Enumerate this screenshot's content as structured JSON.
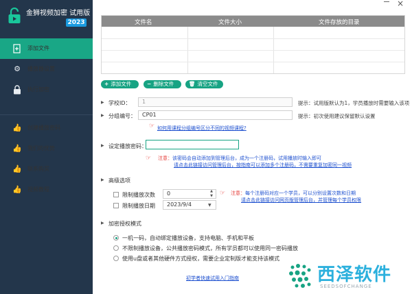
{
  "app": {
    "title": "金狮视频加密 试用版",
    "year_badge": "2023",
    "colors": {
      "sidebar": "#23364b",
      "accent": "#19a786",
      "badge": "#1a9be0",
      "link": "#1c4fcf",
      "warning": "#e53935"
    }
  },
  "sidebar": {
    "items": [
      {
        "label": "添加文件",
        "icon": "file-plus-icon",
        "active": true
      },
      {
        "label": "播放器设置",
        "icon": "gear-icon",
        "active": false
      },
      {
        "label": "执行加密",
        "icon": "lock-icon",
        "active": false
      },
      {
        "label": "创建播放密码",
        "icon": "thumbs-up-icon",
        "active": false
      },
      {
        "label": "我们的优势",
        "icon": "thumbs-up-icon",
        "active": false
      },
      {
        "label": "联系购买",
        "icon": "thumbs-up-icon",
        "active": false
      },
      {
        "label": "视频教程",
        "icon": "thumbs-up-icon",
        "active": false
      }
    ]
  },
  "files_table": {
    "headers": [
      "文件名",
      "文件大小",
      "文件存放的目录"
    ],
    "rows": []
  },
  "toolbar": {
    "add_file": "添加文件",
    "delete_file": "删除文件",
    "clear_files": "清空文件"
  },
  "form": {
    "school_id": {
      "label": "学校ID：",
      "value": "1",
      "hint": "提示：试用版默认为1，学员播放时需要输入该项"
    },
    "group_no": {
      "label": "分组编号：",
      "value": "CP01",
      "hint": "提示：初次使用建议保留默认设置"
    },
    "group_link": "如何用课程分组编号区分不同的视频课程?",
    "play_password": {
      "label": "设定播放密码：",
      "value": ""
    },
    "password_note_prefix": "注意：",
    "password_note_1": "该密码会自动添加到管理后台，成为一个注册码，试用播放时输入即可",
    "password_note_2": "请点击此链接访问管理后台，按指南可以添加多个注册码，不需要重复加密同一视频"
  },
  "advanced": {
    "title": "高级选项",
    "limit_count": {
      "label": "限制播放次数",
      "value": "0",
      "checked": false
    },
    "limit_date": {
      "label": "限制播放日期",
      "value": "2023/9/4",
      "checked": false
    },
    "note_prefix": "注意：",
    "note_1": "每个注册码对应一个学员，可以分别设置次数和日期",
    "note_2": "请点击此链接访问网页版管理后台，并管理每个学员权限"
  },
  "auth_mode": {
    "title": "加密授权模式",
    "options": [
      {
        "label": "一机一码，自动绑定播放设备，支持电脑、手机和平板",
        "selected": true
      },
      {
        "label": "不限制播放设备，公共播放密码模式，所有学员都可以使用同一密码播放",
        "selected": false
      },
      {
        "label": "使用u盘或者其他硬件方式授权，需要企业定制版才能支持该模式",
        "selected": false
      }
    ],
    "guide_link": "初学者快速试用入门指南"
  },
  "watermark": {
    "text": "西泽软件",
    "sub": "SEEDSOFCHANGE"
  }
}
